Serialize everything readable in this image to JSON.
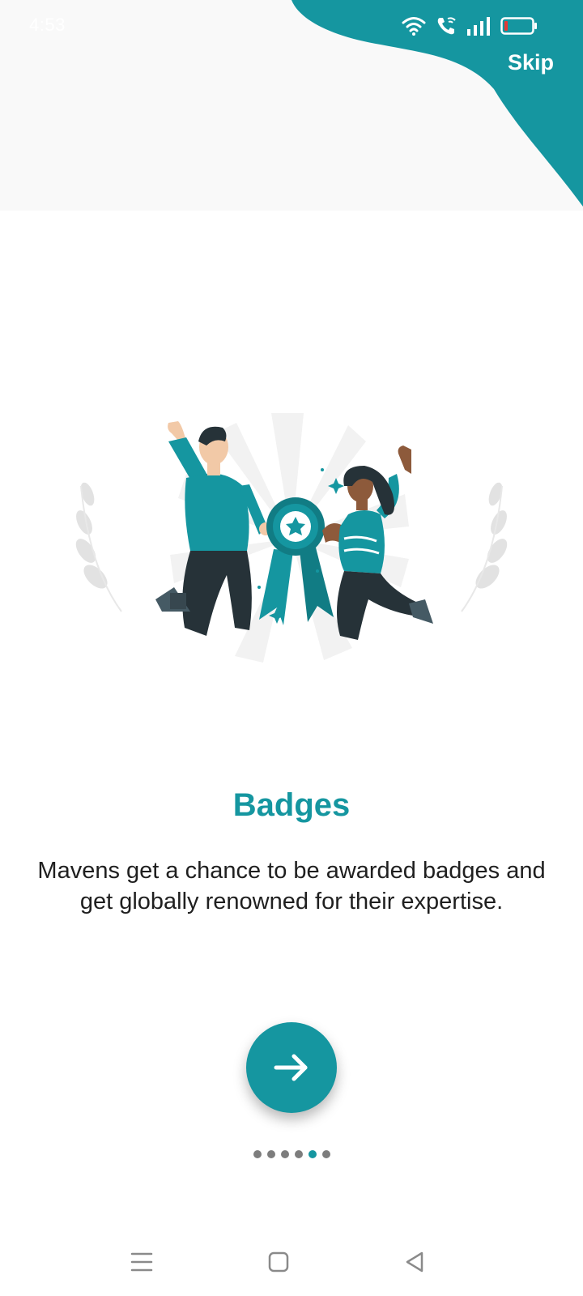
{
  "colors": {
    "accent": "#1596a0",
    "text": "#1f1f1f",
    "dot_inactive": "#7d7d7d"
  },
  "status_bar": {
    "time": "4:53",
    "icons": [
      "wifi-icon",
      "wifi-call-icon",
      "signal-icon",
      "battery-low-icon"
    ]
  },
  "header": {
    "skip_label": "Skip"
  },
  "illustration": {
    "subject": "celebration-award-badge"
  },
  "onboarding": {
    "title": "Badges",
    "description": "Mavens get a chance to be awarded badges and get globally renowned for their expertise.",
    "next_icon": "arrow-right-icon"
  },
  "pager": {
    "total": 6,
    "active_index": 4
  },
  "nav_bar": {
    "icons": [
      "menu-icon",
      "home-icon",
      "back-icon"
    ]
  }
}
